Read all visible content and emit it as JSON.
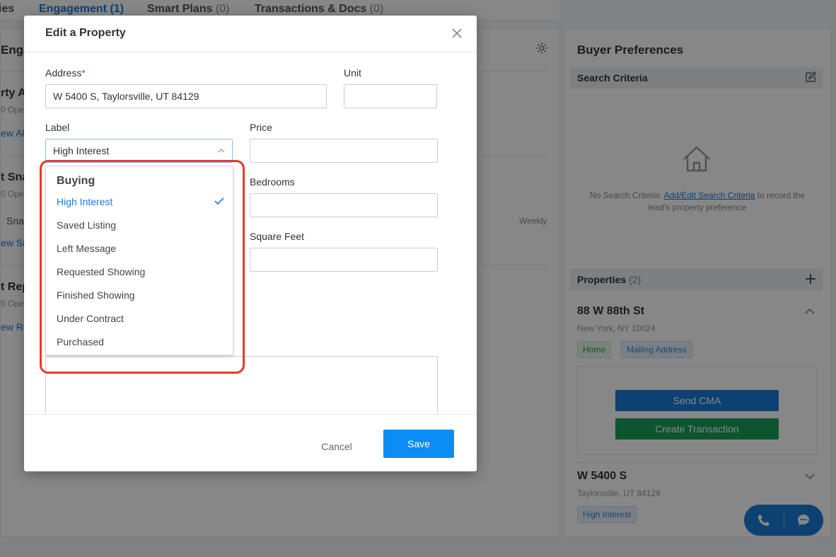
{
  "tabs": [
    {
      "label": "ies",
      "count": ""
    },
    {
      "label": "Engagement",
      "count": "(1)"
    },
    {
      "label": "Smart Plans",
      "count": "(0)"
    },
    {
      "label": "Transactions & Docs",
      "count": "(0)"
    }
  ],
  "left_panel": {
    "title": "Enga",
    "sections": [
      {
        "heading": "rty A",
        "sub": "0 Ope",
        "link": "ew Ale"
      },
      {
        "heading": "t Sna",
        "sub": "0 Ope",
        "text": "Sna",
        "frequency": "Weekly",
        "link": "ew Sn"
      },
      {
        "heading": "t Rep",
        "sub": "0 Ope",
        "link": "ew Re"
      }
    ]
  },
  "right_panel": {
    "title": "Buyer Preferences",
    "search_criteria": {
      "label": "Search Criteria",
      "empty_prefix": "No Search Criteria. ",
      "empty_link": "Add/Edit Search Criteria",
      "empty_suffix": " to record the lead's property preference"
    },
    "properties": {
      "label": "Properties",
      "count": "(2)",
      "items": [
        {
          "address": "88 W 88th St",
          "city": "New York, NY 10024",
          "badges": [
            "Home",
            "Mailing Address"
          ]
        },
        {
          "address": "W 5400 S",
          "city": "Taylorsville, UT 84129",
          "badges": [
            "High Interest"
          ]
        }
      ],
      "send_cma": "Send CMA",
      "create_transaction": "Create Transaction"
    }
  },
  "modal": {
    "title": "Edit a Property",
    "address_label": "Address",
    "required_mark": "*",
    "address_value": "W 5400 S, Taylorsville, UT 84129",
    "unit_label": "Unit",
    "unit_value": "",
    "label_label": "Label",
    "label_value": "High Interest",
    "price_label": "Price",
    "bedrooms_label": "Bedrooms",
    "sqft_label": "Square Feet",
    "cancel": "Cancel",
    "save": "Save"
  },
  "dropdown": {
    "group": "Buying",
    "options": [
      "High Interest",
      "Saved Listing",
      "Left Message",
      "Requested Showing",
      "Finished Showing",
      "Under Contract",
      "Purchased"
    ],
    "selected": "High Interest"
  },
  "colors": {
    "accent": "#1a7bd8",
    "save_button": "#0a8ef5",
    "transaction_button": "#18a05a",
    "highlight": "#e43a2b"
  }
}
